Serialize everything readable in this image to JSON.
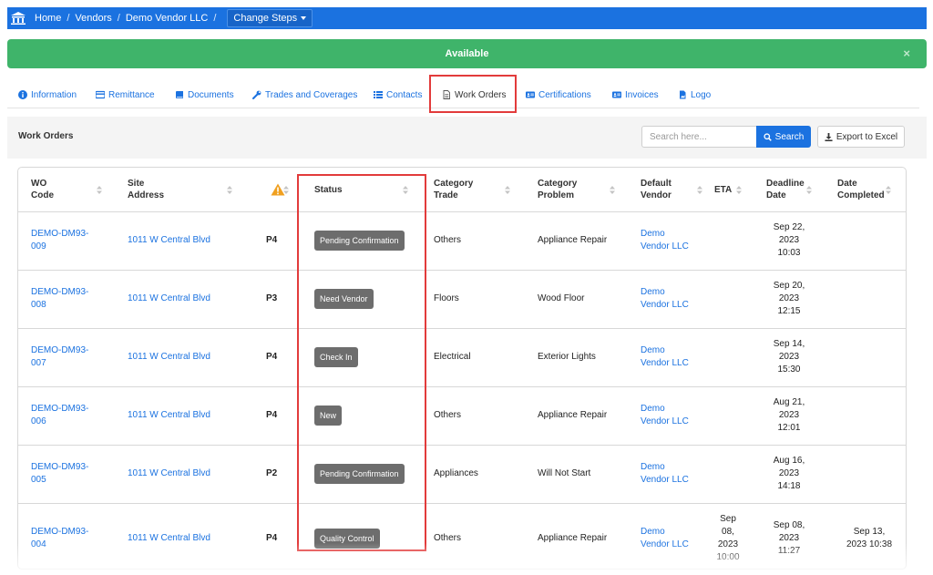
{
  "breadcrumb": {
    "home": "Home",
    "vendors": "Vendors",
    "vendor": "Demo Vendor LLC",
    "change_steps": "Change Steps",
    "sep": "/"
  },
  "banner": {
    "text": "Available",
    "close": "×"
  },
  "tabs": [
    {
      "label": "Information",
      "icon": "info-icon"
    },
    {
      "label": "Remittance",
      "icon": "card-icon"
    },
    {
      "label": "Documents",
      "icon": "book-icon"
    },
    {
      "label": "Trades and Coverages",
      "icon": "wrench-icon"
    },
    {
      "label": "Contacts",
      "icon": "list-icon"
    },
    {
      "label": "Work Orders",
      "icon": "file-icon",
      "active": true
    },
    {
      "label": "Certifications",
      "icon": "id-card-icon"
    },
    {
      "label": "Invoices",
      "icon": "id-card-icon"
    },
    {
      "label": "Logo",
      "icon": "image-file-icon"
    }
  ],
  "panel": {
    "title": "Work Orders",
    "search_placeholder": "Search here...",
    "search_label": "Search",
    "export_label": "Export to Excel"
  },
  "table": {
    "headers": {
      "wo_code": [
        "WO",
        "Code"
      ],
      "site": [
        "Site",
        "Address"
      ],
      "priority_icon": "warning-icon",
      "status": "Status",
      "cat_trade": [
        "Category",
        "Trade"
      ],
      "cat_problem": [
        "Category",
        "Problem"
      ],
      "vendor": [
        "Default",
        "Vendor"
      ],
      "eta": "ETA",
      "deadline": [
        "Deadline",
        "Date"
      ],
      "completed": [
        "Date",
        "Completed"
      ]
    },
    "rows": [
      {
        "code": [
          "DEMO-DM93-",
          "009"
        ],
        "site": "1011 W Central Blvd",
        "priority": "P4",
        "status": "Pending Confirmation",
        "trade": "Others",
        "problem": "Appliance Repair",
        "vendor": [
          "Demo",
          "Vendor LLC"
        ],
        "eta": [],
        "deadline": [
          "Sep 22,",
          "2023",
          "10:03"
        ],
        "completed": []
      },
      {
        "code": [
          "DEMO-DM93-",
          "008"
        ],
        "site": "1011 W Central Blvd",
        "priority": "P3",
        "status": "Need Vendor",
        "trade": "Floors",
        "problem": "Wood Floor",
        "vendor": [
          "Demo",
          "Vendor LLC"
        ],
        "eta": [],
        "deadline": [
          "Sep 20,",
          "2023",
          "12:15"
        ],
        "completed": []
      },
      {
        "code": [
          "DEMO-DM93-",
          "007"
        ],
        "site": "1011 W Central Blvd",
        "priority": "P4",
        "status": "Check In",
        "trade": "Electrical",
        "problem": "Exterior Lights",
        "vendor": [
          "Demo",
          "Vendor LLC"
        ],
        "eta": [],
        "deadline": [
          "Sep 14,",
          "2023",
          "15:30"
        ],
        "completed": []
      },
      {
        "code": [
          "DEMO-DM93-",
          "006"
        ],
        "site": "1011 W Central Blvd",
        "priority": "P4",
        "status": "New",
        "trade": "Others",
        "problem": "Appliance Repair",
        "vendor": [
          "Demo",
          "Vendor LLC"
        ],
        "eta": [],
        "deadline": [
          "Aug 21,",
          "2023",
          "12:01"
        ],
        "completed": []
      },
      {
        "code": [
          "DEMO-DM93-",
          "005"
        ],
        "site": "1011 W Central Blvd",
        "priority": "P2",
        "status": "Pending Confirmation",
        "trade": "Appliances",
        "problem": "Will Not Start",
        "vendor": [
          "Demo",
          "Vendor LLC"
        ],
        "eta": [],
        "deadline": [
          "Aug 16,",
          "2023",
          "14:18"
        ],
        "completed": []
      },
      {
        "code": [
          "DEMO-DM93-",
          "004"
        ],
        "site": "1011 W Central Blvd",
        "priority": "P4",
        "status": "Quality Control",
        "trade": "Others",
        "problem": "Appliance Repair",
        "vendor": [
          "Demo",
          "Vendor LLC"
        ],
        "eta": [
          "Sep",
          "08,",
          "2023",
          "10:00"
        ],
        "deadline": [
          "Sep 08,",
          "2023",
          "11:27"
        ],
        "completed": [
          "Sep 13,",
          "2023 10:38"
        ]
      }
    ]
  },
  "colors": {
    "primary": "#1b72e0",
    "success": "#3fb46a",
    "badge": "#6d6d6d",
    "highlight": "#e23b3b",
    "warning": "#f0a020"
  }
}
